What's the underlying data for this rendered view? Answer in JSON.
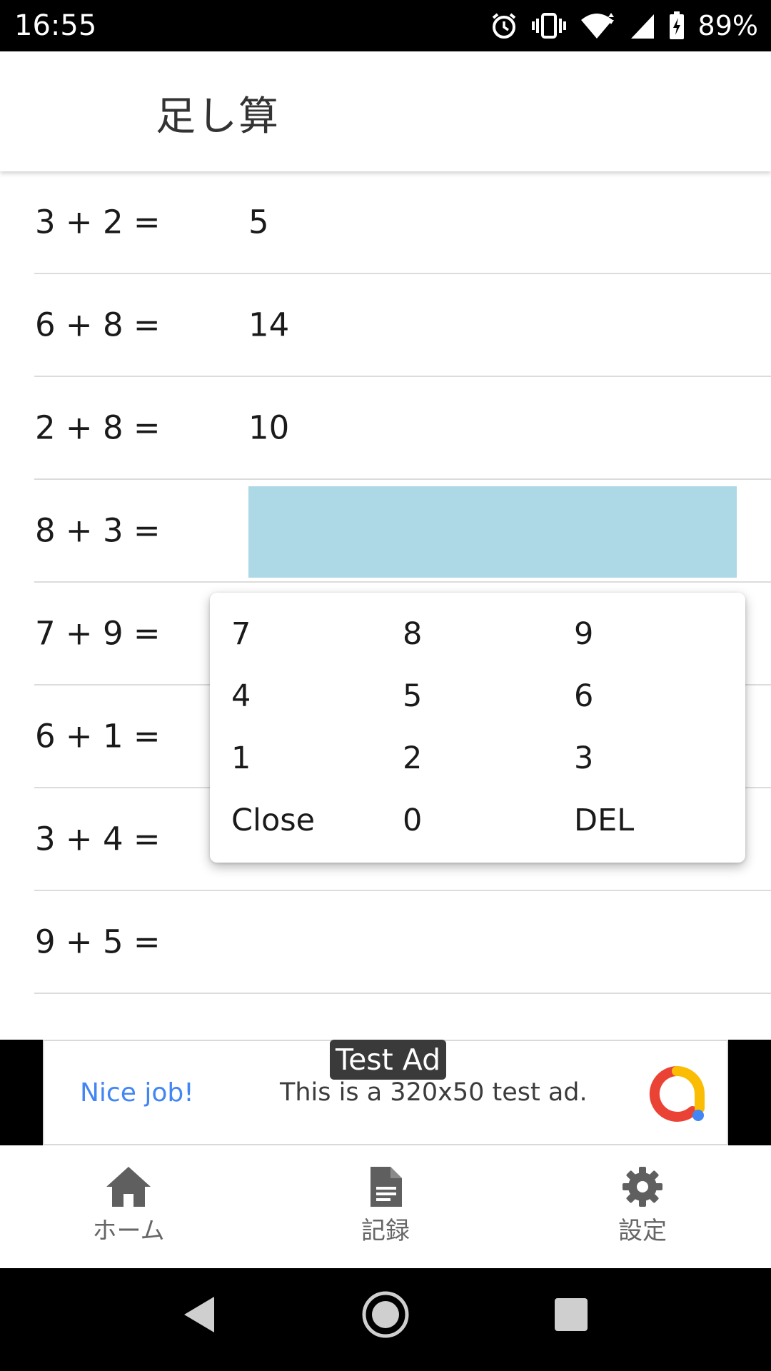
{
  "status_bar": {
    "time": "16:55",
    "battery_percent": "89%",
    "icons": [
      "alarm-icon",
      "vibrate-icon",
      "wifi-icon",
      "cell-signal-icon",
      "battery-charging-icon"
    ]
  },
  "app_bar": {
    "title": "足し算"
  },
  "problems": [
    {
      "question": "3 + 2 =",
      "answer": "5"
    },
    {
      "question": "6 + 8 =",
      "answer": "14"
    },
    {
      "question": "2 + 8 =",
      "answer": "10"
    },
    {
      "question": "8 + 3 =",
      "answer": ""
    },
    {
      "question": "7 + 9 =",
      "answer": ""
    },
    {
      "question": "6 + 1 =",
      "answer": ""
    },
    {
      "question": "3 + 4 =",
      "answer": ""
    },
    {
      "question": "9 + 5 =",
      "answer": ""
    }
  ],
  "colors": {
    "active_input": "#add8e6",
    "ad_accent": "#4285f4"
  },
  "keypad": {
    "rows": [
      [
        "7",
        "8",
        "9"
      ],
      [
        "4",
        "5",
        "6"
      ],
      [
        "1",
        "2",
        "3"
      ],
      [
        "Close",
        "0",
        "DEL"
      ]
    ]
  },
  "ad": {
    "badge": "Test Ad",
    "headline": "Nice job!",
    "text": "This is a 320x50 test ad."
  },
  "bottom_nav": {
    "items": [
      {
        "label": "ホーム",
        "icon": "home-icon"
      },
      {
        "label": "記録",
        "icon": "document-icon"
      },
      {
        "label": "設定",
        "icon": "gear-icon"
      }
    ]
  },
  "system_nav": {
    "icons": [
      "back-icon",
      "home-circle-icon",
      "recents-icon"
    ]
  }
}
